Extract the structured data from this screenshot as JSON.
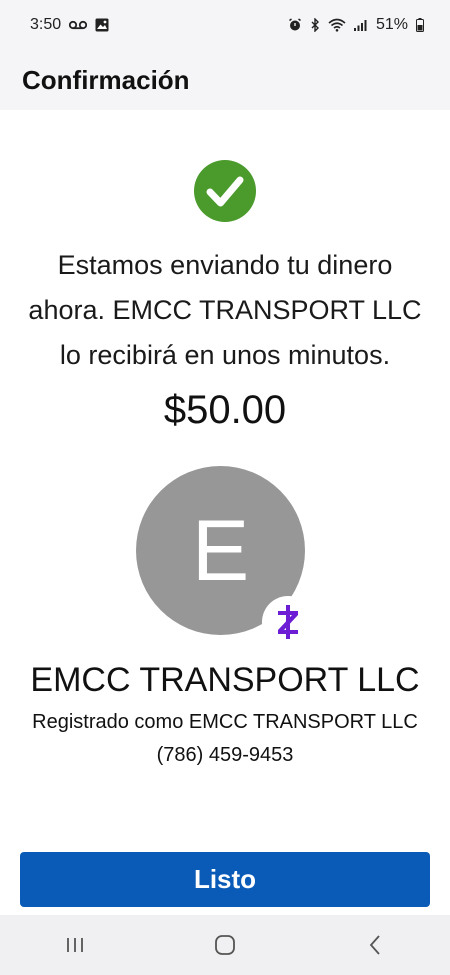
{
  "status_bar": {
    "time": "3:50",
    "battery": "51%"
  },
  "header": {
    "title": "Confirmación"
  },
  "confirmation": {
    "message": "Estamos enviando tu dinero ahora. EMCC TRANSPORT LLC lo recibirá en unos minutos.",
    "amount": "$50.00",
    "status_color": "#4a9a2c"
  },
  "recipient": {
    "initial": "E",
    "name": "EMCC TRANSPORT LLC",
    "registered_as": "Registrado como EMCC TRANSPORT LLC",
    "phone": "(786) 459-9453",
    "badge_icon": "zelle-icon",
    "badge_color": "#6d1ed4"
  },
  "actions": {
    "done_label": "Listo",
    "done_color": "#0a5bb8"
  },
  "nav": {
    "items": [
      "recent-apps-icon",
      "home-icon",
      "back-icon"
    ]
  }
}
